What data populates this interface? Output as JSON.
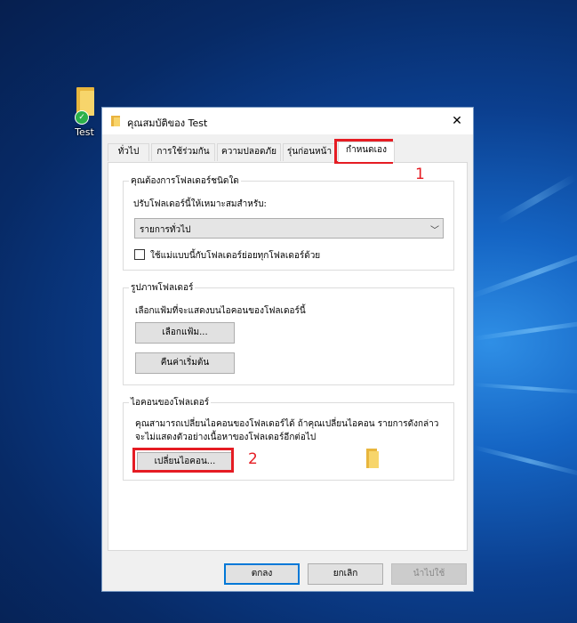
{
  "desktop": {
    "icon_label": "Test"
  },
  "dialog": {
    "title": "คุณสมบัติของ Test",
    "tabs": [
      "ทั่วไป",
      "การใช้ร่วมกัน",
      "ความปลอดภัย",
      "รุ่นก่อนหน้า",
      "กำหนดเอง"
    ],
    "active_tab": "กำหนดเอง",
    "optimize": {
      "group_title": "คุณต้องการโฟลเดอร์ชนิดใด",
      "prompt": "ปรับโฟลเดอร์นี้ให้เหมาะสมสำหรับ:",
      "selected": "รายการทั่วไป",
      "apply_sub_label": "ใช้แม่แบบนี้กับโฟลเดอร์ย่อยทุกโฟลเดอร์ด้วย"
    },
    "folder_pictures": {
      "group_title": "รูปภาพโฟลเดอร์",
      "desc": "เลือกแฟ้มที่จะแสดงบนไอคอนของโฟลเดอร์นี้",
      "choose_file": "เลือกแฟ้ม...",
      "restore_default": "คืนค่าเริ่มต้น"
    },
    "folder_icons": {
      "group_title": "ไอคอนของโฟลเดอร์",
      "desc_line1": "คุณสามารถเปลี่ยนไอคอนของโฟลเดอร์ได้ ถ้าคุณเปลี่ยนไอคอน รายการดังกล่าว",
      "desc_line2": "จะไม่แสดงตัวอย่างเนื้อหาของโฟลเดอร์อีกต่อไป",
      "change_icon": "เปลี่ยนไอคอน..."
    },
    "buttons": {
      "ok": "ตกลง",
      "cancel": "ยกเลิก",
      "apply": "นำไปใช้"
    }
  },
  "annotations": {
    "marker1": "1",
    "marker2": "2",
    "color": "#e51c23"
  }
}
